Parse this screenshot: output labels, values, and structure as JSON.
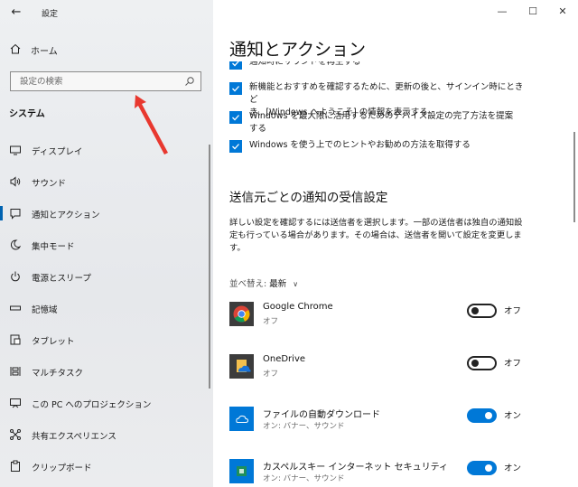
{
  "window": {
    "title": "設定",
    "back_glyph": "←",
    "minimize_glyph": "—",
    "maximize_glyph": "☐",
    "close_glyph": "✕"
  },
  "sidebar": {
    "home_label": "ホーム",
    "search_placeholder": "設定の検索",
    "section_title": "システム",
    "items": [
      {
        "label": "ディスプレイ",
        "icon": "display-icon"
      },
      {
        "label": "サウンド",
        "icon": "speaker-icon"
      },
      {
        "label": "通知とアクション",
        "icon": "notification-icon",
        "active": true
      },
      {
        "label": "集中モード",
        "icon": "moon-icon"
      },
      {
        "label": "電源とスリープ",
        "icon": "power-icon"
      },
      {
        "label": "記憶域",
        "icon": "storage-icon"
      },
      {
        "label": "タブレット",
        "icon": "tablet-icon"
      },
      {
        "label": "マルチタスク",
        "icon": "multitask-icon"
      },
      {
        "label": "この PC へのプロジェクション",
        "icon": "projection-icon"
      },
      {
        "label": "共有エクスペリエンス",
        "icon": "share-icon"
      },
      {
        "label": "クリップボード",
        "icon": "clipboard-icon"
      }
    ]
  },
  "main": {
    "title": "通知とアクション",
    "checkboxes": [
      {
        "text": "通知時にサウンドを再生する",
        "checked": true
      },
      {
        "text": "新機能とおすすめを確認するために、更新の後と、サインイン時にときど\nき、[Windows へようこそ] の情報を表示する",
        "checked": true
      },
      {
        "text": "Windows を最大限に活用するためのデバイス設定の完了方法を提案\nする",
        "checked": true
      },
      {
        "text": "Windows を使う上でのヒントやお勧めの方法を取得する",
        "checked": true
      }
    ],
    "senders_heading": "送信元ごとの通知の受信設定",
    "senders_desc": "詳しい設定を確認するには送信者を選択します。一部の送信者は独自の通知設定も行っている場合があります。その場合は、送信者を開いて設定を変更します。",
    "sort_label": "並べ替え:",
    "sort_value": "最新",
    "senders": [
      {
        "name": "Google Chrome",
        "sub": "オフ",
        "toggle": "オフ",
        "on": false,
        "icon": "chrome-icon"
      },
      {
        "name": "OneDrive",
        "sub": "オフ",
        "toggle": "オフ",
        "on": false,
        "icon": "onedrive-icon"
      },
      {
        "name": "ファイルの自動ダウンロード",
        "sub": "オン: バナー、サウンド",
        "toggle": "オン",
        "on": true,
        "icon": "cloud-icon"
      },
      {
        "name": "カスペルスキー インターネット セキュリティ",
        "sub": "オン: バナー、サウンド",
        "toggle": "オン",
        "on": true,
        "icon": "kaspersky-icon"
      }
    ]
  },
  "colors": {
    "accent": "#0078d7",
    "sidebar_bg": "#e9ebee",
    "arrow": "#e8382f"
  }
}
